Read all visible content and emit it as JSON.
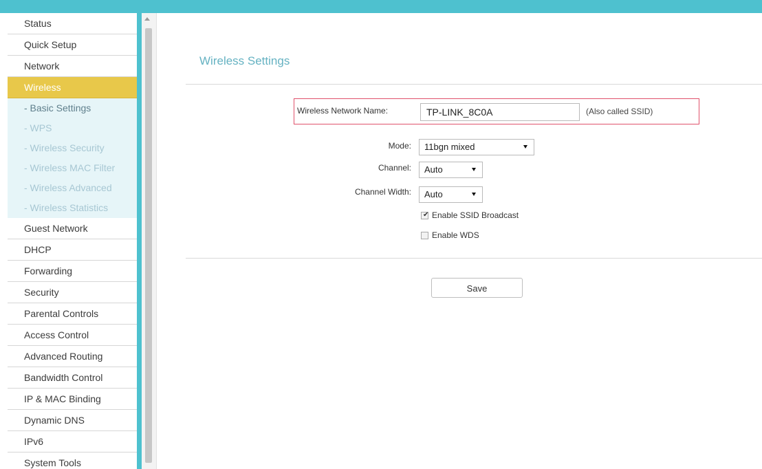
{
  "sidebar": {
    "items_before": [
      "Status",
      "Quick Setup",
      "Network"
    ],
    "active_item": "Wireless",
    "sub_items": [
      "- Basic Settings",
      "- WPS",
      "- Wireless Security",
      "- Wireless MAC Filter",
      "- Wireless Advanced",
      "- Wireless Statistics"
    ],
    "items_after": [
      "Guest Network",
      "DHCP",
      "Forwarding",
      "Security",
      "Parental Controls",
      "Access Control",
      "Advanced Routing",
      "Bandwidth Control",
      "IP & MAC Binding",
      "Dynamic DNS",
      "IPv6",
      "System Tools"
    ]
  },
  "main": {
    "title": "Wireless Settings",
    "ssid": {
      "label": "Wireless Network Name:",
      "value": "TP-LINK_8C0A",
      "note": "(Also called SSID)"
    },
    "mode": {
      "label": "Mode:",
      "value": "11bgn mixed"
    },
    "channel": {
      "label": "Channel:",
      "value": "Auto"
    },
    "channel_width": {
      "label": "Channel Width:",
      "value": "Auto"
    },
    "ssid_broadcast": {
      "label": "Enable SSID Broadcast",
      "checked": true
    },
    "wds": {
      "label": "Enable WDS",
      "checked": false
    },
    "save_label": "Save"
  },
  "colors": {
    "accent": "#4ec1cf",
    "active_menu": "#e8c84a",
    "title": "#65b2c2",
    "highlight_border": "#e0506a"
  }
}
